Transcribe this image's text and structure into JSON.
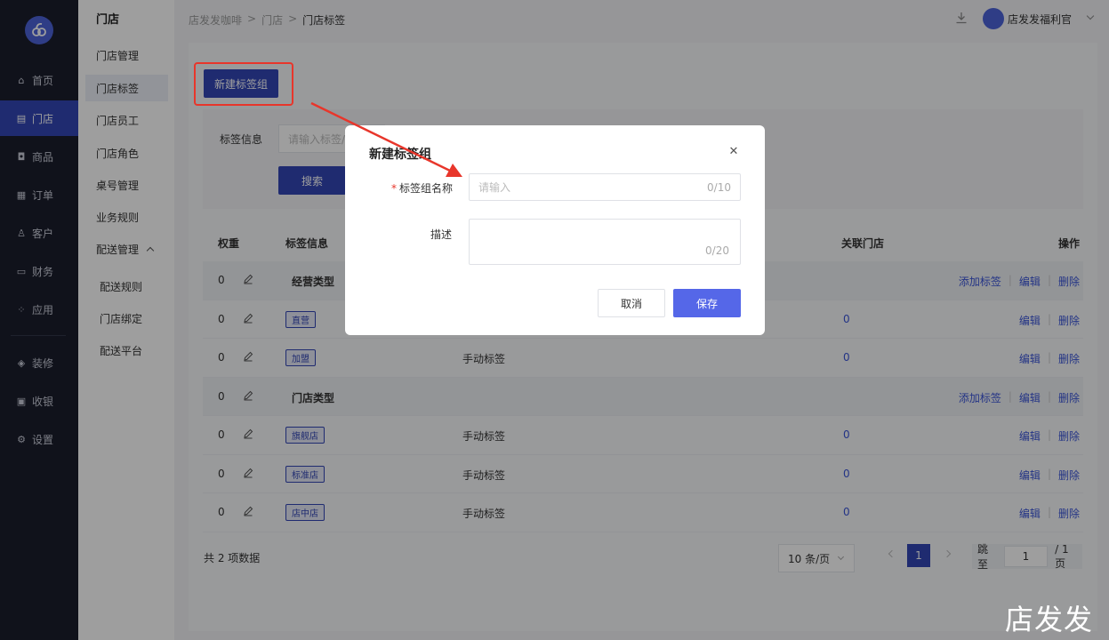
{
  "nav": {
    "items": [
      {
        "label": "首页",
        "icon": "home-icon"
      },
      {
        "label": "门店",
        "icon": "store-icon",
        "active": true
      },
      {
        "label": "商品",
        "icon": "bag-icon"
      },
      {
        "label": "订单",
        "icon": "order-icon"
      },
      {
        "label": "客户",
        "icon": "user-icon"
      },
      {
        "label": "财务",
        "icon": "wallet-icon"
      },
      {
        "label": "应用",
        "icon": "apps-icon"
      },
      {
        "label": "装修",
        "icon": "layers-icon"
      },
      {
        "label": "收银",
        "icon": "cashier-icon"
      },
      {
        "label": "设置",
        "icon": "settings-icon"
      }
    ]
  },
  "sub": {
    "title": "门店",
    "items": [
      "门店管理",
      "门店标签",
      "门店员工",
      "门店角色",
      "桌号管理",
      "业务规则",
      "配送管理"
    ],
    "children": [
      "配送规则",
      "门店绑定",
      "配送平台"
    ]
  },
  "header": {
    "breadcrumb": [
      "店发发咖啡",
      ">",
      "门店",
      ">",
      "门店标签"
    ],
    "user_name": "店发发福利官"
  },
  "toolbar": {
    "new_group_label": "新建标签组"
  },
  "filter": {
    "label": "标签信息",
    "placeholder": "请输入标签/",
    "search_label": "搜索"
  },
  "table": {
    "headers": {
      "weight": "权重",
      "info": "标签信息",
      "stores": "关联门店",
      "ops": "操作"
    },
    "rows": [
      {
        "weight": "0",
        "name": "经营类型",
        "group": true,
        "ops": [
          "添加标签",
          "编辑",
          "删除"
        ]
      },
      {
        "weight": "0",
        "tag": "直营",
        "type": "",
        "count": "0",
        "ops": [
          "编辑",
          "删除"
        ]
      },
      {
        "weight": "0",
        "tag": "加盟",
        "type": "手动标签",
        "count": "0",
        "ops": [
          "编辑",
          "删除"
        ]
      },
      {
        "weight": "0",
        "name": "门店类型",
        "group": true,
        "ops": [
          "添加标签",
          "编辑",
          "删除"
        ]
      },
      {
        "weight": "0",
        "tag": "旗舰店",
        "type": "手动标签",
        "count": "0",
        "ops": [
          "编辑",
          "删除"
        ]
      },
      {
        "weight": "0",
        "tag": "标准店",
        "type": "手动标签",
        "count": "0",
        "ops": [
          "编辑",
          "删除"
        ]
      },
      {
        "weight": "0",
        "tag": "店中店",
        "type": "手动标签",
        "count": "0",
        "ops": [
          "编辑",
          "删除"
        ]
      }
    ]
  },
  "footer": {
    "total": "共 2 项数据",
    "page_size": "10 条/页",
    "current_page": "1",
    "jump_label": "跳至",
    "jump_value": "1",
    "total_pages": "/ 1 页"
  },
  "modal": {
    "title": "新建标签组",
    "name_label": "标签组名称",
    "name_placeholder": "请输入",
    "name_counter": "0/10",
    "desc_label": "描述",
    "desc_counter": "0/20",
    "cancel_label": "取消",
    "save_label": "保存"
  },
  "watermark": "店发发",
  "colors": {
    "primary": "#3346b5",
    "nav_bg": "#1a1d2c",
    "save": "#5567e8",
    "annotation": "#e8362b"
  }
}
